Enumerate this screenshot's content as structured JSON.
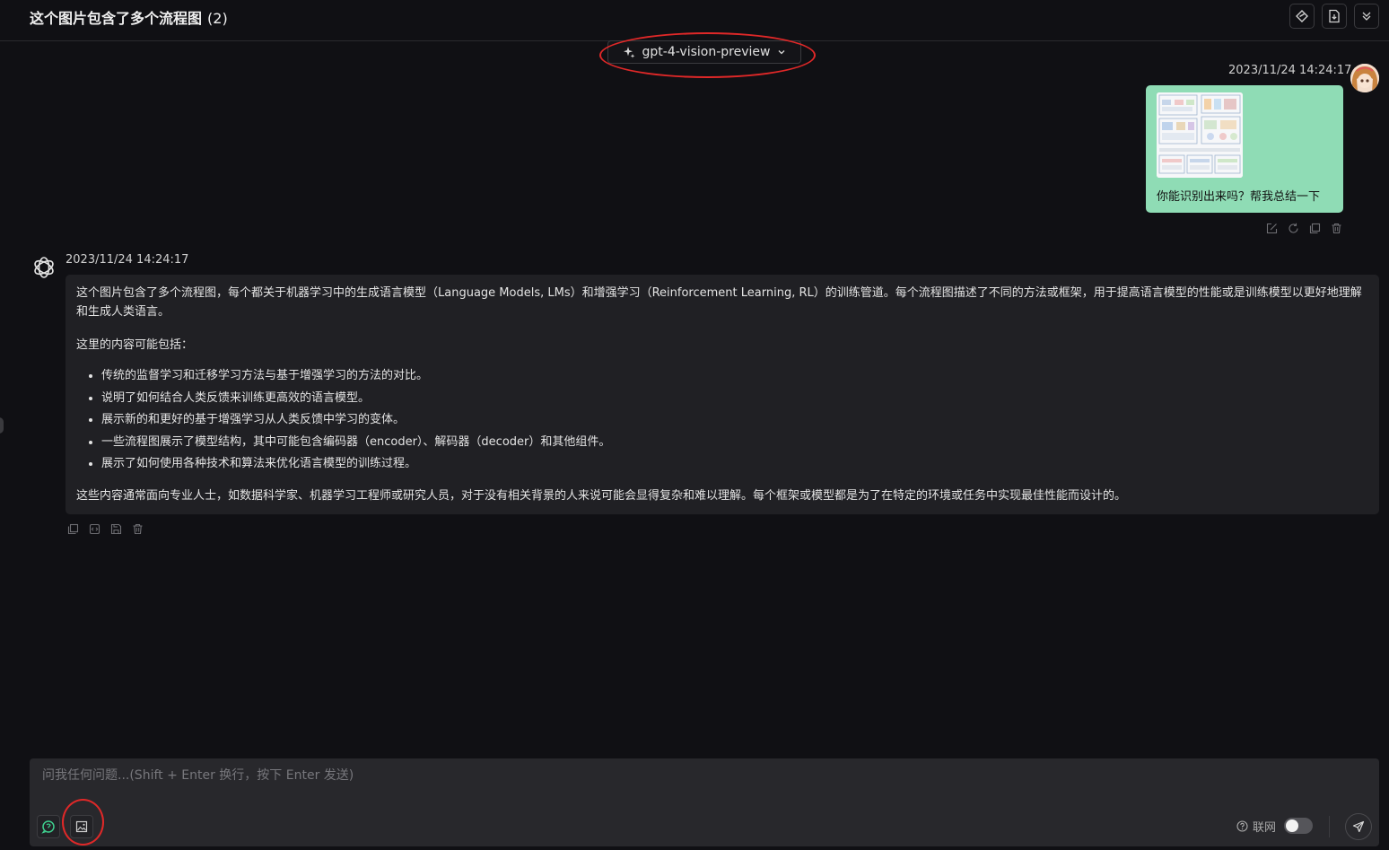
{
  "header": {
    "title": "这个图片包含了多个流程图",
    "count": "(2)",
    "buttons": [
      {
        "icon": "diamond-edit-icon"
      },
      {
        "icon": "file-export-icon"
      },
      {
        "icon": "collapse-down-icon"
      }
    ]
  },
  "model_selector": {
    "icon": "sparkle-icon",
    "label": "gpt-4-vision-preview",
    "caret_icon": "chevron-down-icon"
  },
  "messages": [
    {
      "role": "user",
      "timestamp": "2023/11/24 14:24:17",
      "avatar": "avatar",
      "attachment": "flowchart-thumbnail",
      "text": "你能识别出来吗？帮我总结一下",
      "actions": [
        "edit-icon",
        "refresh-icon",
        "copy-icon",
        "trash-icon"
      ],
      "bubble_color": "#8fdcb5"
    },
    {
      "role": "assistant",
      "timestamp": "2023/11/24 14:24:17",
      "avatar": "openai-logo-icon",
      "intro": "这个图片包含了多个流程图，每个都关于机器学习中的生成语言模型（Language Models, LMs）和增强学习（Reinforcement Learning, RL）的训练管道。每个流程图描述了不同的方法或框架，用于提高语言模型的性能或是训练模型以更好地理解和生成人类语言。",
      "list_intro": "这里的内容可能包括：",
      "items": [
        "传统的监督学习和迁移学习方法与基于增强学习的方法的对比。",
        "说明了如何结合人类反馈来训练更高效的语言模型。",
        "展示新的和更好的基于增强学习从人类反馈中学习的变体。",
        "一些流程图展示了模型结构，其中可能包含编码器（encoder）、解码器（decoder）和其他组件。",
        "展示了如何使用各种技术和算法来优化语言模型的训练过程。"
      ],
      "conclusion": "这些内容通常面向专业人士，如数据科学家、机器学习工程师或研究人员，对于没有相关背景的人来说可能会显得复杂和难以理解。每个框架或模型都是为了在特定的环境或任务中实现最佳性能而设计的。",
      "actions": [
        "copy-icon",
        "code-icon",
        "save-icon",
        "trash-icon"
      ]
    }
  ],
  "composer": {
    "placeholder": "问我任何问题...(Shift + Enter 换行，按下 Enter 发送)",
    "value": "",
    "tools": [
      "prompt-icon",
      "image-upload-icon"
    ],
    "web_search_label": "联网",
    "web_search_enabled": false,
    "send_icon": "send-icon"
  },
  "annotation_color": "#e02828"
}
